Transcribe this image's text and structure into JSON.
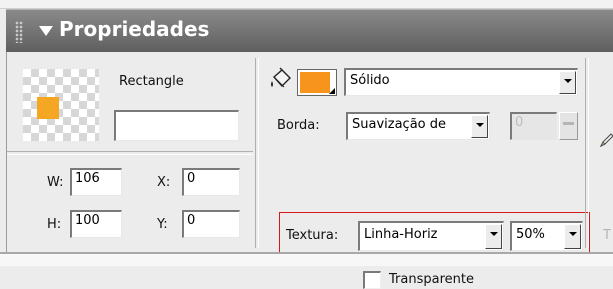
{
  "panel": {
    "title": "Propriedades"
  },
  "shape": {
    "type_label": "Rectangle",
    "name_value": ""
  },
  "dimensions": {
    "w_label": "W:",
    "w_value": "106",
    "h_label": "H:",
    "h_value": "100",
    "x_label": "X:",
    "x_value": "0",
    "y_label": "Y:",
    "y_value": "0"
  },
  "fill": {
    "color": "#f7941d",
    "style_value": "Sólido"
  },
  "border": {
    "label": "Borda:",
    "style_value": "Suavização de",
    "amount_value": "0"
  },
  "texture": {
    "label": "Textura:",
    "value": "Linha-Horiz",
    "percent_value": "50%"
  },
  "transparent": {
    "label": "Transparente",
    "checked": false
  },
  "right_cutoff": {
    "partial_label": "T"
  },
  "colors": {
    "highlight_border": "#d2191a",
    "header_bg": "#6f6f6f",
    "thumb_fill": "#f5a623"
  },
  "icons": [
    "grip-icon",
    "collapse-triangle-icon",
    "paint-bucket-icon",
    "pencil-icon",
    "dropdown-arrow-icon"
  ]
}
